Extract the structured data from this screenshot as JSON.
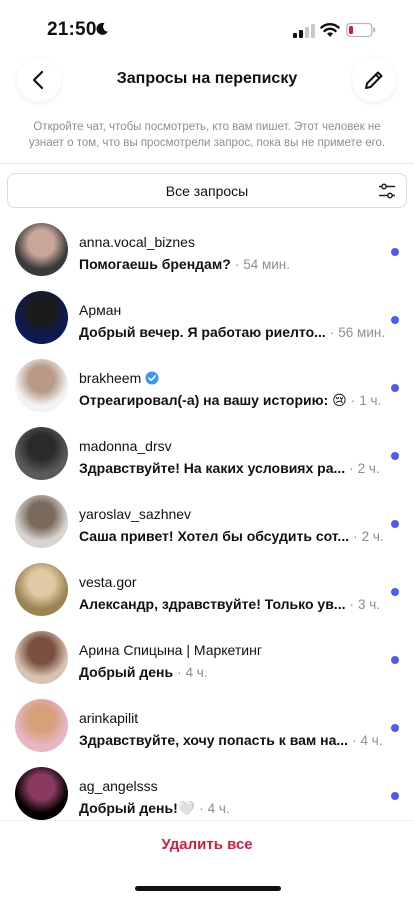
{
  "status_bar": {
    "time": "21:50"
  },
  "header": {
    "title": "Запросы на переписку"
  },
  "info_text": "Откройте чат, чтобы посмотреть, кто вам пишет. Этот человек не узнает о том, что вы просмотрели запрос, пока вы не примете его.",
  "filter": {
    "label": "Все запросы"
  },
  "requests": [
    {
      "name": "anna.vocal_biznes",
      "message": "Помогаешь брендам?",
      "sep": " · ",
      "time": "54 мин.",
      "avatar": {
        "bg": "#3a3a3a",
        "fg": "#c9a89a"
      }
    },
    {
      "name": "Арман",
      "message": "Добрый вечер. Я работаю риелто...",
      "sep": " · ",
      "time": "56 мин.",
      "avatar": {
        "bg": "#0c1a55",
        "fg": "#1b1b1b"
      }
    },
    {
      "name": "brakheem",
      "message": "Отреагировал(-а) на вашу историю: 😢",
      "sep": " · ",
      "time": "1 ч.",
      "avatar": {
        "bg": "#f2f2f2",
        "fg": "#b89a86"
      }
    },
    {
      "name": "madonna_drsv",
      "message": "Здравствуйте! На каких условиях ра...",
      "sep": " · ",
      "time": "2 ч.",
      "avatar": {
        "bg": "#5a5a5a",
        "fg": "#2a2a2a"
      }
    },
    {
      "name": "yaroslav_sazhnev",
      "message": "Саша привет! Хотел бы обсудить сот...",
      "sep": " · ",
      "time": "2 ч.",
      "avatar": {
        "bg": "#d9d4cf",
        "fg": "#7a6a5e"
      }
    },
    {
      "name": "vesta.gor",
      "message": "Александр, здравствуйте! Только ув...",
      "sep": " · ",
      "time": "3 ч.",
      "avatar": {
        "bg": "#9a8452",
        "fg": "#e0c9a4"
      }
    },
    {
      "name": "Арина Спицына | Маркетинг",
      "message": "Добрый день",
      "sep": " · ",
      "time": "4 ч.",
      "avatar": {
        "bg": "#d8c3b2",
        "fg": "#7a5040"
      }
    },
    {
      "name": "arinkapilit",
      "message": "Здравствуйте, хочу попасть к вам на...",
      "sep": " · ",
      "time": "4 ч.",
      "avatar": {
        "bg": "#e8b5c4",
        "fg": "#d6a07a"
      }
    },
    {
      "name": "ag_angelsss",
      "message": "Добрый день!🤍",
      "sep": " · ",
      "time": "4 ч.",
      "avatar": {
        "bg": "#000000",
        "fg": "#8a3a60"
      }
    }
  ],
  "footer": {
    "delete_all": "Удалить все"
  },
  "colors": {
    "unread": "#4b5cf5",
    "delete": "#e0193a",
    "verified": "#3897f0"
  }
}
